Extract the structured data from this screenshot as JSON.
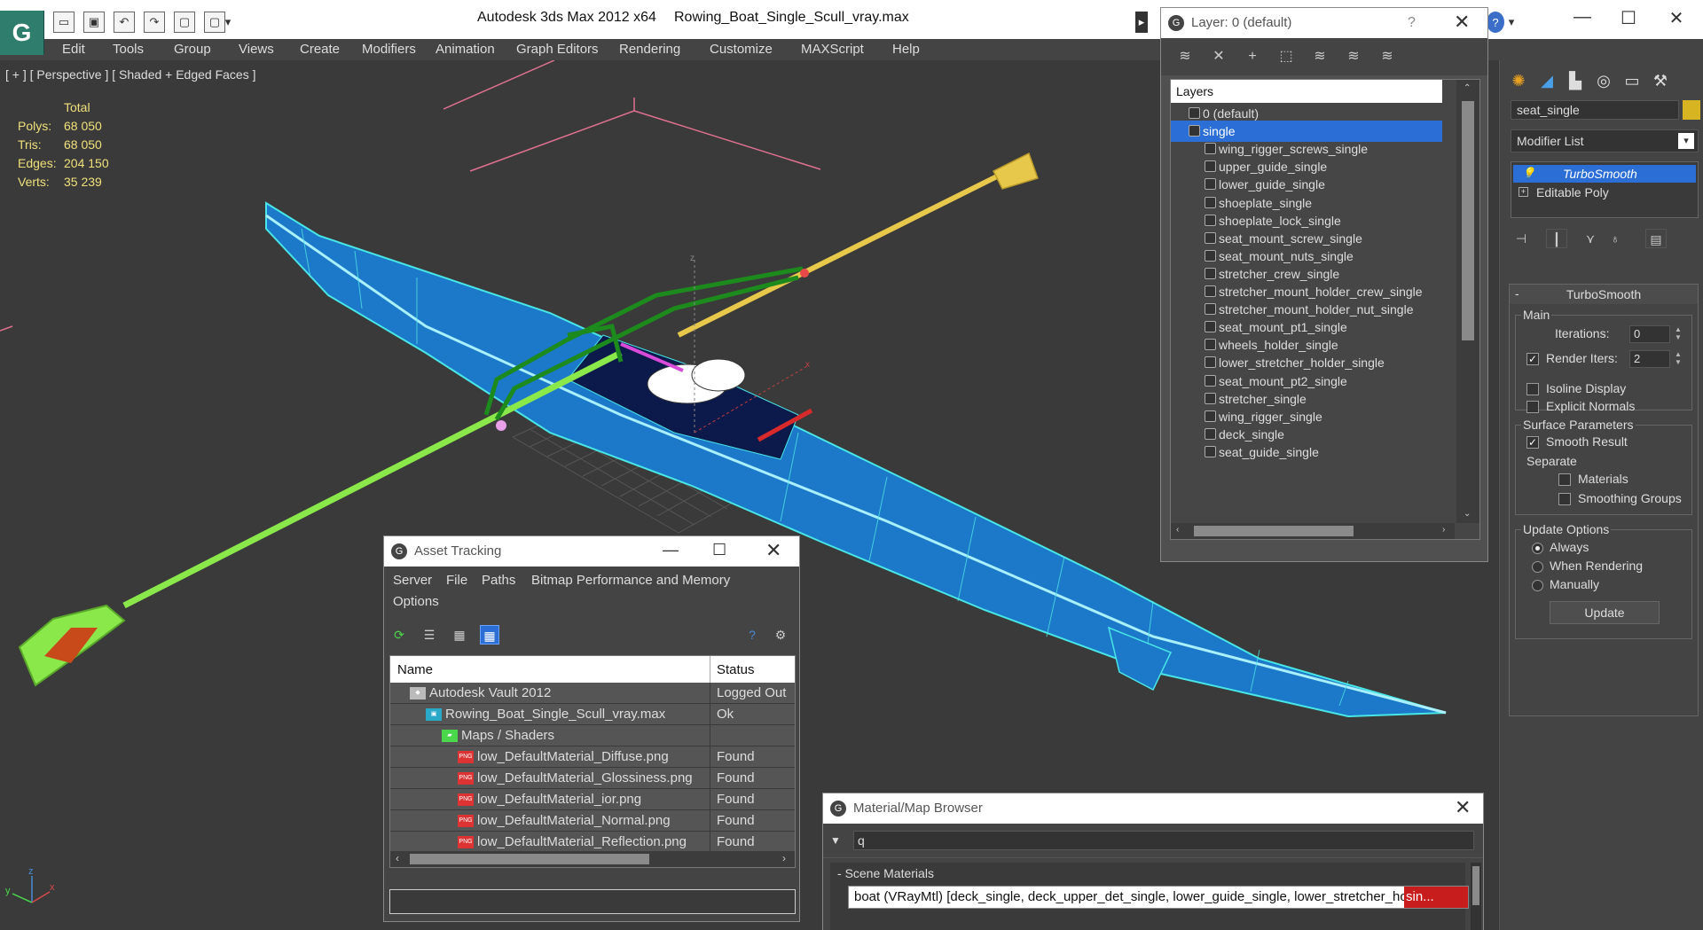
{
  "window": {
    "app_title": "Autodesk 3ds Max  2012 x64",
    "file_title": "Rowing_Boat_Single_Scull_vray.max"
  },
  "menu": [
    "Edit",
    "Tools",
    "Group",
    "Views",
    "Create",
    "Modifiers",
    "Animation",
    "Graph Editors",
    "Rendering",
    "Customize",
    "MAXScript",
    "Help"
  ],
  "viewport": {
    "label": "[ + ] [ Perspective ] [ Shaded + Edged Faces ]",
    "stats_header": "Total",
    "stats": [
      {
        "k": "Polys:",
        "v": "68 050"
      },
      {
        "k": "Tris:",
        "v": "68 050"
      },
      {
        "k": "Edges:",
        "v": "204 150"
      },
      {
        "k": "Verts:",
        "v": "35 239"
      }
    ],
    "axis_labels": {
      "z": "z",
      "x": "x",
      "y": "y"
    }
  },
  "layer_manager": {
    "title": "Layer: 0 (default)",
    "help": "?",
    "header": "Layers",
    "rows": [
      {
        "label": "0 (default)",
        "indent": 1,
        "selected": false
      },
      {
        "label": "single",
        "indent": 1,
        "selected": true
      },
      {
        "label": "wing_rigger_screws_single",
        "indent": 2,
        "selected": false
      },
      {
        "label": "upper_guide_single",
        "indent": 2,
        "selected": false
      },
      {
        "label": "lower_guide_single",
        "indent": 2,
        "selected": false
      },
      {
        "label": "shoeplate_single",
        "indent": 2,
        "selected": false
      },
      {
        "label": "shoeplate_lock_single",
        "indent": 2,
        "selected": false
      },
      {
        "label": "seat_mount_screw_single",
        "indent": 2,
        "selected": false
      },
      {
        "label": "seat_mount_nuts_single",
        "indent": 2,
        "selected": false
      },
      {
        "label": "stretcher_crew_single",
        "indent": 2,
        "selected": false
      },
      {
        "label": "stretcher_mount_holder_crew_single",
        "indent": 2,
        "selected": false
      },
      {
        "label": "stretcher_mount_holder_nut_single",
        "indent": 2,
        "selected": false
      },
      {
        "label": "seat_mount_pt1_single",
        "indent": 2,
        "selected": false
      },
      {
        "label": "wheels_holder_single",
        "indent": 2,
        "selected": false
      },
      {
        "label": "lower_stretcher_holder_single",
        "indent": 2,
        "selected": false
      },
      {
        "label": "seat_mount_pt2_single",
        "indent": 2,
        "selected": false
      },
      {
        "label": "stretcher_single",
        "indent": 2,
        "selected": false
      },
      {
        "label": "wing_rigger_single",
        "indent": 2,
        "selected": false
      },
      {
        "label": "deck_single",
        "indent": 2,
        "selected": false
      },
      {
        "label": "seat_guide_single",
        "indent": 2,
        "selected": false
      }
    ]
  },
  "command_panel": {
    "object_name": "seat_single",
    "object_color": "#d6b422",
    "modifier_list_label": "Modifier List",
    "stack": [
      {
        "label": "TurboSmooth",
        "selected": true
      },
      {
        "label": "Editable Poly",
        "selected": false
      }
    ],
    "turbosmooth": {
      "rollout_title": "TurboSmooth",
      "main_group": "Main",
      "iterations_label": "Iterations:",
      "iterations_value": "0",
      "render_iters_label": "Render Iters:",
      "render_iters_value": "2",
      "render_iters_checked": true,
      "isoline_label": "Isoline Display",
      "explicit_normals_label": "Explicit Normals",
      "surface_group": "Surface Parameters",
      "smooth_result_label": "Smooth Result",
      "smooth_result_checked": true,
      "separate_label": "Separate",
      "materials_label": "Materials",
      "smoothing_groups_label": "Smoothing Groups",
      "update_group": "Update Options",
      "always_label": "Always",
      "when_rendering_label": "When Rendering",
      "manually_label": "Manually",
      "update_button": "Update"
    }
  },
  "asset_tracking": {
    "title": "Asset Tracking",
    "menu": [
      "Server",
      "File",
      "Paths",
      "Bitmap Performance and Memory",
      "Options"
    ],
    "col_name": "Name",
    "col_status": "Status",
    "rows": [
      {
        "name": "Autodesk Vault 2012",
        "status": "Logged Out",
        "indent": 1,
        "icon": "vault"
      },
      {
        "name": "Rowing_Boat_Single_Scull_vray.max",
        "status": "Ok",
        "indent": 2,
        "icon": "max"
      },
      {
        "name": "Maps / Shaders",
        "status": "",
        "indent": 3,
        "icon": "maps"
      },
      {
        "name": "low_DefaultMaterial_Diffuse.png",
        "status": "Found",
        "indent": 4,
        "icon": "png"
      },
      {
        "name": "low_DefaultMaterial_Glossiness.png",
        "status": "Found",
        "indent": 4,
        "icon": "png"
      },
      {
        "name": "low_DefaultMaterial_ior.png",
        "status": "Found",
        "indent": 4,
        "icon": "png"
      },
      {
        "name": "low_DefaultMaterial_Normal.png",
        "status": "Found",
        "indent": 4,
        "icon": "png"
      },
      {
        "name": "low_DefaultMaterial_Reflection.png",
        "status": "Found",
        "indent": 4,
        "icon": "png"
      }
    ],
    "png_badge": "PNG"
  },
  "material_browser": {
    "title": "Material/Map Browser",
    "search_value": "q",
    "group_label": "Scene Materials",
    "entry_text": "boat (VRayMtl) [deck_single, deck_upper_det_single, lower_guide_single, lower_stretcher_holder_sin...",
    "entry_tail": "sin..."
  }
}
